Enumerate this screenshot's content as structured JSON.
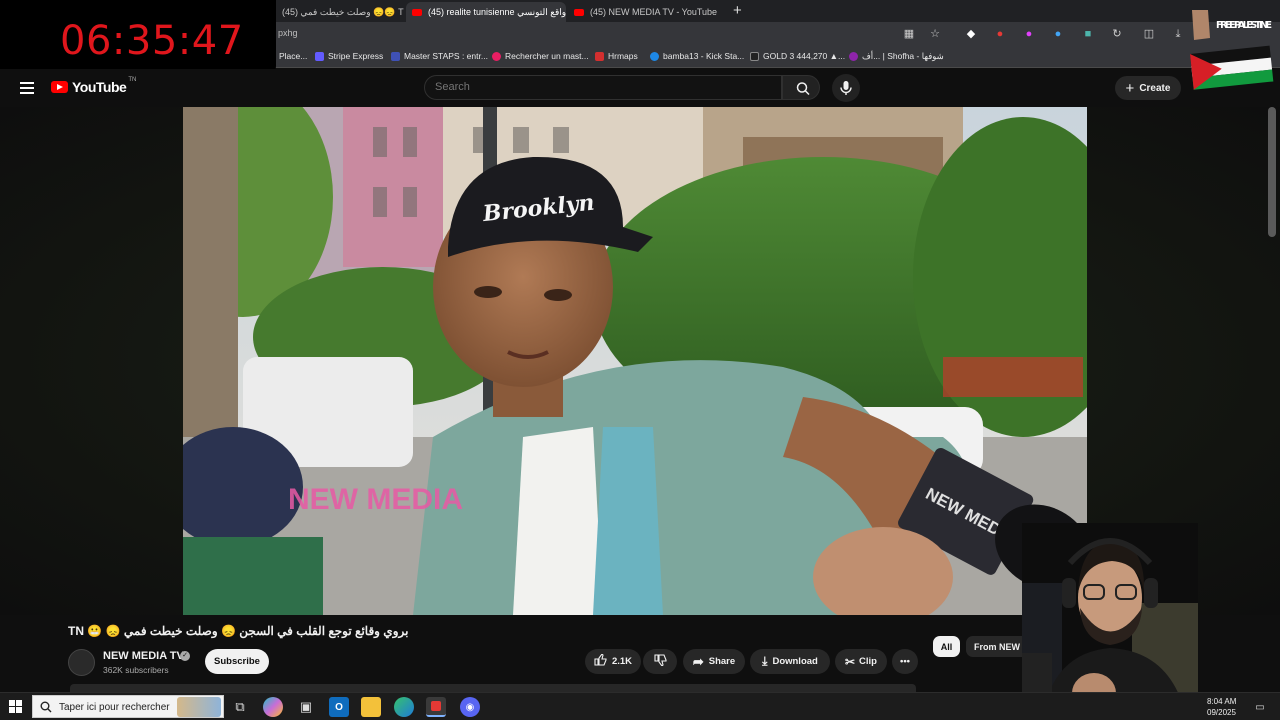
{
  "clock": {
    "time": "06:35:47"
  },
  "browser": {
    "tabs": [
      {
        "label": "(45) ‫TN 😞😞 وصلت خيطت فمي‬"
      },
      {
        "label": "(45) realite tunisienne واقع التونسي"
      },
      {
        "label": "(45) NEW MEDIA TV - YouTube"
      }
    ],
    "url": "pxhg",
    "bookmarks": [
      {
        "label": "Place...",
        "color": "#4caf50"
      },
      {
        "label": "Stripe Express",
        "color": "#635bff"
      },
      {
        "label": "Master STAPS : entr...",
        "color": "#3f51b5"
      },
      {
        "label": "Rechercher un mast...",
        "color": "#e91e63"
      },
      {
        "label": "Hrmaps",
        "color": "#d32f2f"
      },
      {
        "label": "bamba13 - Kick Sta...",
        "color": "#1e88e5"
      },
      {
        "label": "GOLD 3 444,270 ▲...",
        "color": "#222222"
      },
      {
        "label": "أف... | Shofha - شوفها",
        "color": "#8e24aa"
      }
    ]
  },
  "overlay": {
    "palestine_text": "FREE PALESTINE"
  },
  "youtube": {
    "logo_text": "YouTube",
    "country_code": "TN",
    "search_placeholder": "Search",
    "create_label": "Create",
    "video_watermark": "NEW MEDIA",
    "mic_watermark": "NEW MEDIA",
    "video_title": "بروي وقائع توجع القلب في السجن 😞 وصلت خيطت فمي 😞 😬 TN",
    "channel_name": "NEW MEDIA TV",
    "subscribers": "362K subscribers",
    "subscribe_label": "Subscribe",
    "like_count": "2.1K",
    "share_label": "Share",
    "download_label": "Download",
    "clip_label": "Clip",
    "chips": {
      "all": "All",
      "from": "From NEW"
    }
  },
  "taskbar": {
    "search_placeholder": "Taper ici pour rechercher",
    "time": "8:04 AM",
    "date": "09/2025"
  },
  "colors": {
    "accent": "#ff0000",
    "clock": "#e0161c",
    "background": "#0f0f0f"
  }
}
